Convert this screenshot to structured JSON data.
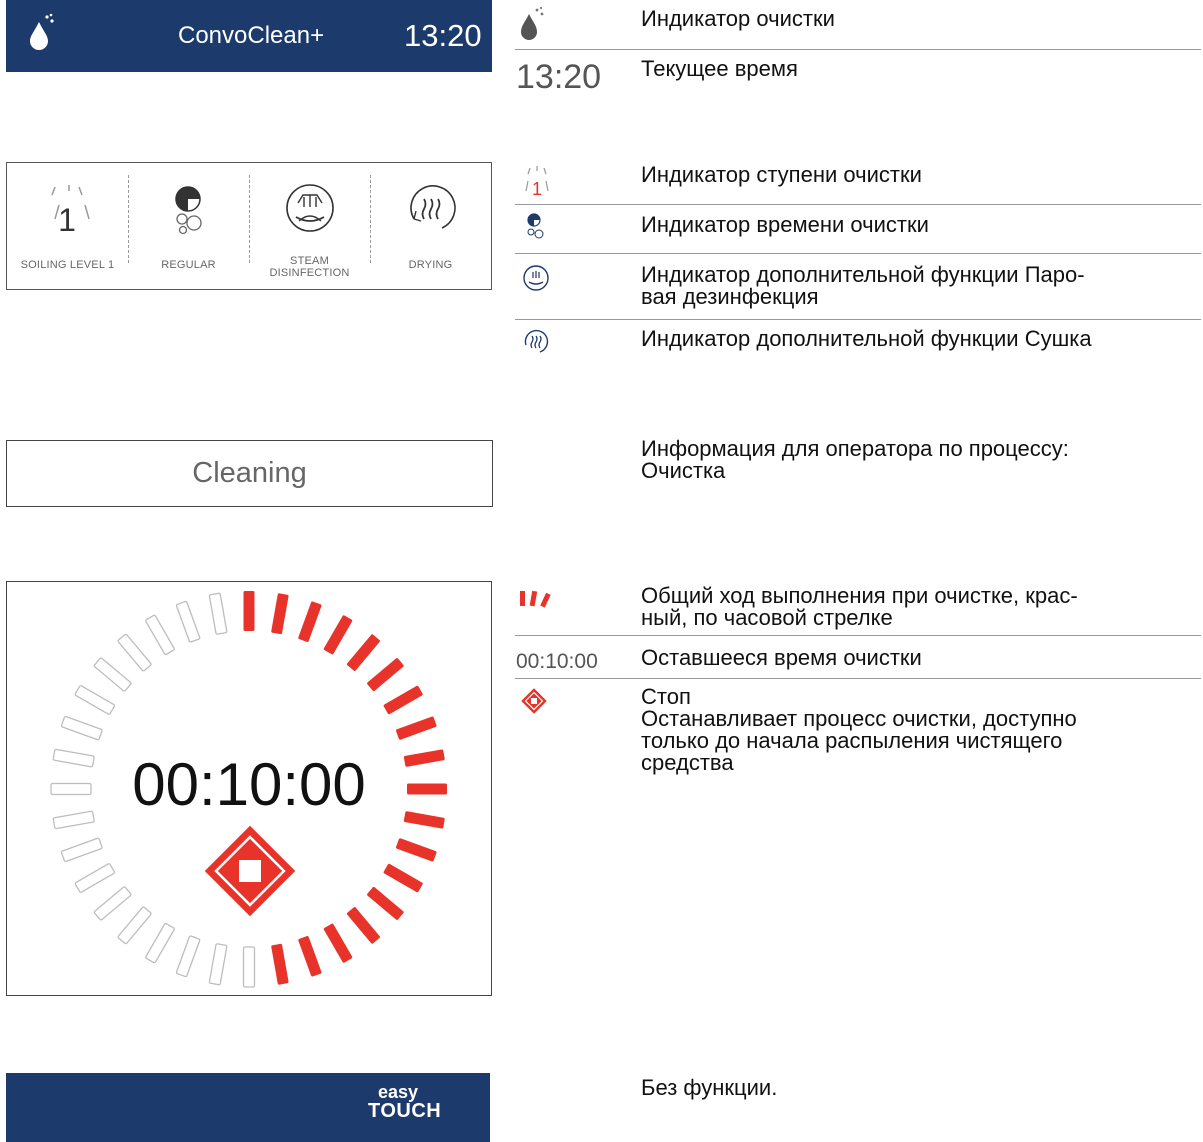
{
  "header": {
    "title": "ConvoClean+",
    "time": "13:20"
  },
  "program_bar": {
    "items": [
      {
        "label": "SOILING LEVEL 1",
        "icon": "soiling-level-1-icon",
        "value": "1"
      },
      {
        "label": "REGULAR",
        "icon": "cleaning-time-icon"
      },
      {
        "label_line1": "STEAM",
        "label_line2": "DISINFECTION",
        "icon": "steam-disinfection-icon"
      },
      {
        "label": "DRYING",
        "icon": "drying-icon"
      }
    ]
  },
  "status": {
    "text": "Cleaning"
  },
  "progress": {
    "remaining": "00:10:00",
    "segments_total": 36,
    "segments_done": 18,
    "done_color": "#e8332a",
    "pending_color": "#bdbdbd"
  },
  "footer": {
    "logo_top": "easy",
    "logo_bottom": "TOUCH"
  },
  "legend": {
    "cleaning_indicator": "Индикатор очистки",
    "current_time_value": "13:20",
    "current_time": "Текущее время",
    "soiling_level_value": "1",
    "soiling_level": "Индикатор ступени очистки",
    "cleaning_time": "Индикатор времени очистки",
    "steam_line1": "Индикатор дополнительной функции Паро-",
    "steam_line2": "вая дезинфекция",
    "drying": "Индикатор дополнительной функции Сушка",
    "process_info_line1": "Информация для оператора по процессу:",
    "process_info_line2": "Очистка",
    "progress_line1": "Общий ход выполнения при очистке, крас-",
    "progress_line2": "ный, по часовой стрелке",
    "remaining_value": "00:10:00",
    "remaining": "Оставшееся время очистки",
    "stop_title": "Стоп",
    "stop_line1": "Останавливает процесс очистки, доступно",
    "stop_line2": "только до начала распыления чистящего",
    "stop_line3": "средства",
    "no_function": "Без функции."
  },
  "colors": {
    "brand_blue": "#1c3a6b",
    "accent_red": "#e8332a"
  }
}
